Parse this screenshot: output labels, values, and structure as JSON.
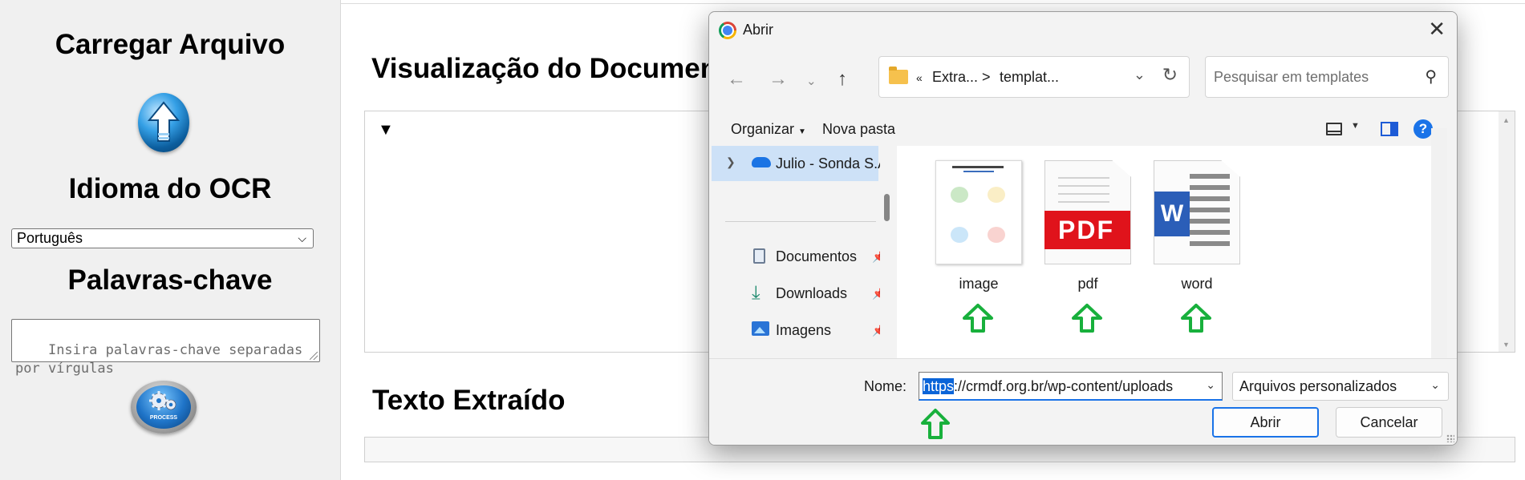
{
  "sidebar": {
    "upload_heading": "Carregar Arquivo",
    "ocr_heading": "Idioma do OCR",
    "ocr_language_selected": "Português",
    "keywords_heading": "Palavras-chave",
    "keywords_placeholder": "Insira palavras-chave separadas\npor vírgulas",
    "process_button_label": "PROCESS"
  },
  "main": {
    "preview_heading": "Visualização do Documento",
    "extracted_heading": "Texto Extraído",
    "preview_toggle": "▼"
  },
  "dialog": {
    "title": "Abrir",
    "address": {
      "crumbs_prefix": "«",
      "crumb_1": "Extra...",
      "crumb_sep": ">",
      "crumb_2": "templat..."
    },
    "search_placeholder": "Pesquisar em templates",
    "toolbar": {
      "organize_label": "Organizar",
      "new_folder_label": "Nova pasta"
    },
    "nav_items": [
      {
        "label": "Julio - Sonda S.A",
        "icon": "onedrive-cloud-icon"
      },
      {
        "label": "Documentos",
        "icon": "documents-icon"
      },
      {
        "label": "Downloads",
        "icon": "download-icon"
      },
      {
        "label": "Imagens",
        "icon": "pictures-icon"
      }
    ],
    "files": [
      {
        "name": "image",
        "type": "image-thumbnail"
      },
      {
        "name": "pdf",
        "type": "pdf-icon"
      },
      {
        "name": "word",
        "type": "word-icon"
      }
    ],
    "name_label": "Nome:",
    "name_value_selected": "https",
    "name_value_rest": "://crmdf.org.br/wp-content/uploads",
    "file_type": "Arquivos personalizados",
    "open_label": "Abrir",
    "cancel_label": "Cancelar"
  },
  "colors": {
    "annotation_arrow": "#18b03c",
    "accent_blue": "#1a73e8",
    "pdf_red": "#e0131b",
    "word_blue": "#2b5eb8"
  }
}
